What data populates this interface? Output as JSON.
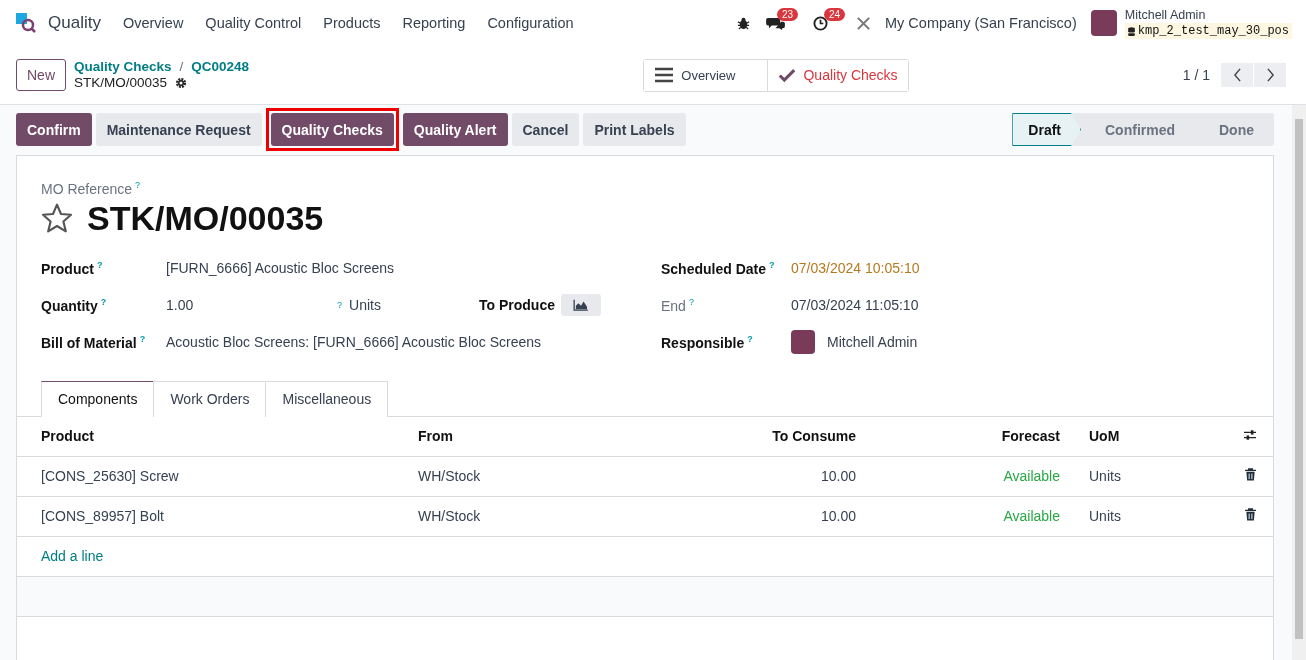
{
  "app": {
    "name": "Quality"
  },
  "menu": [
    "Overview",
    "Quality Control",
    "Products",
    "Reporting",
    "Configuration"
  ],
  "systray": {
    "messages_count": "23",
    "activities_count": "24",
    "company": "My Company (San Francisco)",
    "user": "Mitchell Admin",
    "database": "kmp_2_test_may_30_pos"
  },
  "control_panel": {
    "new_button": "New",
    "breadcrumb": [
      "Quality Checks",
      "QC00248"
    ],
    "separator": "/",
    "record_name": "STK/MO/00035",
    "pager": "1 / 1",
    "smart_buttons": [
      {
        "label": "Overview",
        "kind": "menu"
      },
      {
        "label": "Quality Checks",
        "kind": "check"
      }
    ]
  },
  "actions": [
    {
      "label": "Confirm",
      "kind": "primary",
      "highlighted": false
    },
    {
      "label": "Maintenance Request",
      "kind": "secondary",
      "highlighted": false
    },
    {
      "label": "Quality Checks",
      "kind": "primary",
      "highlighted": true
    },
    {
      "label": "Quality Alert",
      "kind": "primary",
      "highlighted": false
    },
    {
      "label": "Cancel",
      "kind": "secondary",
      "highlighted": false
    },
    {
      "label": "Print Labels",
      "kind": "secondary",
      "highlighted": false
    }
  ],
  "status": [
    {
      "label": "Draft",
      "selected": true
    },
    {
      "label": "Confirmed",
      "selected": false
    },
    {
      "label": "Done",
      "selected": false
    }
  ],
  "form": {
    "ref_label": "MO Reference",
    "ref_help": "?",
    "title": "STK/MO/00035",
    "starred": false,
    "left_fields": [
      {
        "kind": "text",
        "label": "Product",
        "help": "?",
        "value": "[FURN_6666] Acoustic Bloc Screens"
      },
      {
        "kind": "quantity",
        "label": "Quantity",
        "help": "?",
        "value": "1.00",
        "unit_help": "?",
        "unit": "Units",
        "to_produce": "To Produce"
      },
      {
        "kind": "text",
        "label": "Bill of Material",
        "help": "?",
        "value": "Acoustic Bloc Screens: [FURN_6666] Acoustic Bloc Screens"
      }
    ],
    "right_fields": [
      {
        "kind": "text",
        "label": "Scheduled Date",
        "help": "?",
        "value": "07/03/2024 10:05:10",
        "warning": true,
        "readonly": false
      },
      {
        "kind": "text",
        "label": "End",
        "help": "?",
        "value": "07/03/2024 11:05:10",
        "warning": false,
        "readonly": true
      },
      {
        "kind": "user",
        "label": "Responsible",
        "help": "?",
        "value": "Mitchell Admin",
        "warning": false,
        "readonly": false
      }
    ]
  },
  "tabs": [
    {
      "label": "Components",
      "selected": true
    },
    {
      "label": "Work Orders",
      "selected": false
    },
    {
      "label": "Miscellaneous",
      "selected": false
    }
  ],
  "table": {
    "columns": [
      "Product",
      "From",
      "To Consume",
      "Forecast",
      "UoM"
    ],
    "rows": [
      {
        "product": "[CONS_25630] Screw",
        "from": "WH/Stock",
        "to_consume": "10.00",
        "forecast": "Available",
        "uom": "Units"
      },
      {
        "product": "[CONS_89957] Bolt",
        "from": "WH/Stock",
        "to_consume": "10.00",
        "forecast": "Available",
        "uom": "Units"
      }
    ],
    "add_line": "Add a line"
  }
}
